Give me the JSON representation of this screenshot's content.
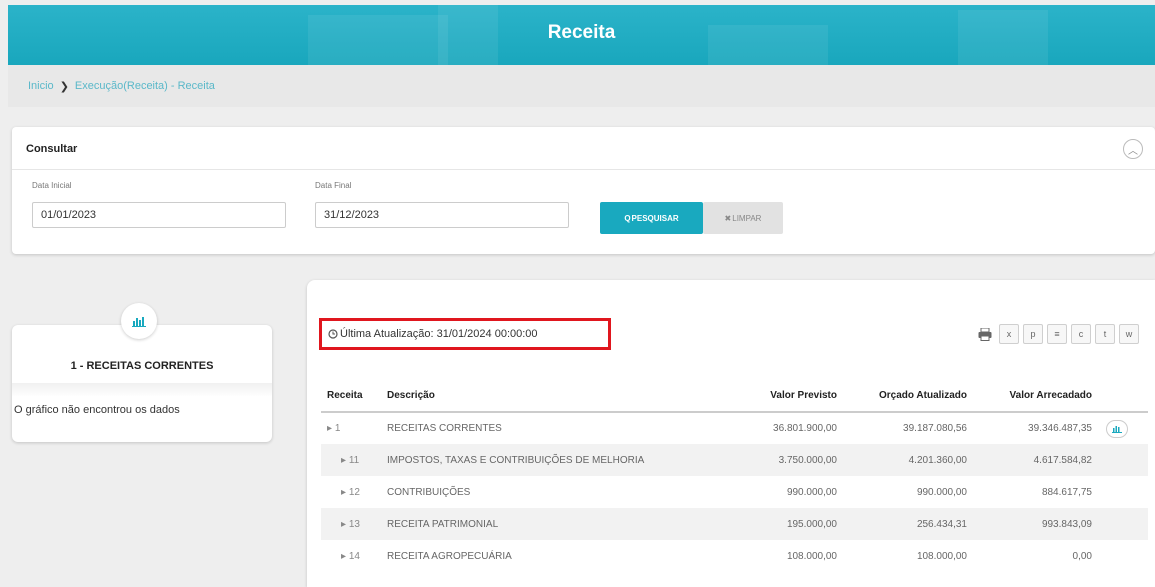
{
  "header": {
    "title": "Receita"
  },
  "breadcrumb": {
    "home": "Inicio",
    "current": "Execução(Receita) - Receita"
  },
  "consultar": {
    "title": "Consultar",
    "data_inicial_label": "Data Inicial",
    "data_inicial_value": "01/01/2023",
    "data_final_label": "Data Final",
    "data_final_value": "31/12/2023",
    "search_label": "PESQUISAR",
    "clear_label": "LIMPAR"
  },
  "side": {
    "title": "1 - RECEITAS CORRENTES",
    "message": "O gráfico não encontrou os dados"
  },
  "table": {
    "last_update": "Última Atualização: 31/01/2024 00:00:00",
    "columns": [
      "Receita",
      "Descrição",
      "Valor Previsto",
      "Orçado Atualizado",
      "Valor Arrecadado"
    ],
    "rows": [
      {
        "code": "1",
        "desc": "RECEITAS CORRENTES",
        "previsto": "36.801.900,00",
        "orcado": "39.187.080,56",
        "arrecadado": "39.346.487,35"
      },
      {
        "code": "11",
        "desc": "IMPOSTOS, TAXAS E CONTRIBUIÇÕES DE MELHORIA",
        "previsto": "3.750.000,00",
        "orcado": "4.201.360,00",
        "arrecadado": "4.617.584,82"
      },
      {
        "code": "12",
        "desc": "CONTRIBUIÇÕES",
        "previsto": "990.000,00",
        "orcado": "990.000,00",
        "arrecadado": "884.617,75"
      },
      {
        "code": "13",
        "desc": "RECEITA PATRIMONIAL",
        "previsto": "195.000,00",
        "orcado": "256.434,31",
        "arrecadado": "993.843,09"
      },
      {
        "code": "14",
        "desc": "RECEITA AGROPECUÁRIA",
        "previsto": "108.000,00",
        "orcado": "108.000,00",
        "arrecadado": "0,00"
      }
    ]
  },
  "colors": {
    "accent": "#19a9bf",
    "highlight_border": "#e0161e"
  },
  "icons": [
    "bar-chart-icon",
    "clock-icon",
    "print-icon",
    "excel-icon",
    "pdf-icon",
    "doc-icon",
    "csv-icon",
    "txt-icon",
    "xml-icon",
    "chevron-up-icon",
    "search-icon",
    "close-icon"
  ]
}
